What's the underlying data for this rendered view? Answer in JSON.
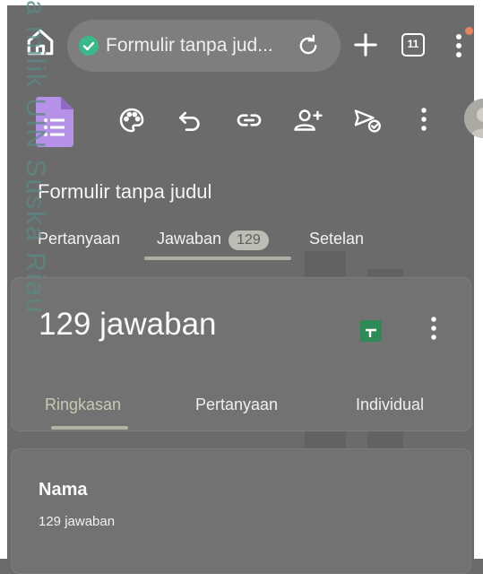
{
  "browser": {
    "url_text": "Formulir tanpa jud...",
    "tab_count": "11"
  },
  "watermark": "a milik UIN Suska Riau",
  "form": {
    "title": "Formulir tanpa judul",
    "tabs": [
      {
        "label": "Pertanyaan"
      },
      {
        "label": "Jawaban",
        "badge": "129"
      },
      {
        "label": "Setelan"
      }
    ]
  },
  "summary": {
    "count_text": "129 jawaban",
    "subtabs": [
      {
        "label": "Ringkasan"
      },
      {
        "label": "Pertanyaan"
      },
      {
        "label": "Individual"
      }
    ]
  },
  "question": {
    "title": "Nama",
    "responses": "129 jawaban"
  },
  "icons": {
    "home": "home-icon",
    "secure": "shield-check-icon",
    "reload": "reload-icon",
    "new_tab": "plus-icon",
    "tabs": "tab-switcher-icon",
    "menu": "more-vert-icon",
    "palette": "palette-icon",
    "undo": "undo-icon",
    "link": "link-icon",
    "add_collaborator": "person-add-icon",
    "send": "send-icon",
    "sheets": "sheets-icon"
  },
  "colors": {
    "secure_green": "#39b98a",
    "forms_purple": "#b691e8",
    "sheets_green": "#2e8a57",
    "notification": "#e8845a"
  }
}
